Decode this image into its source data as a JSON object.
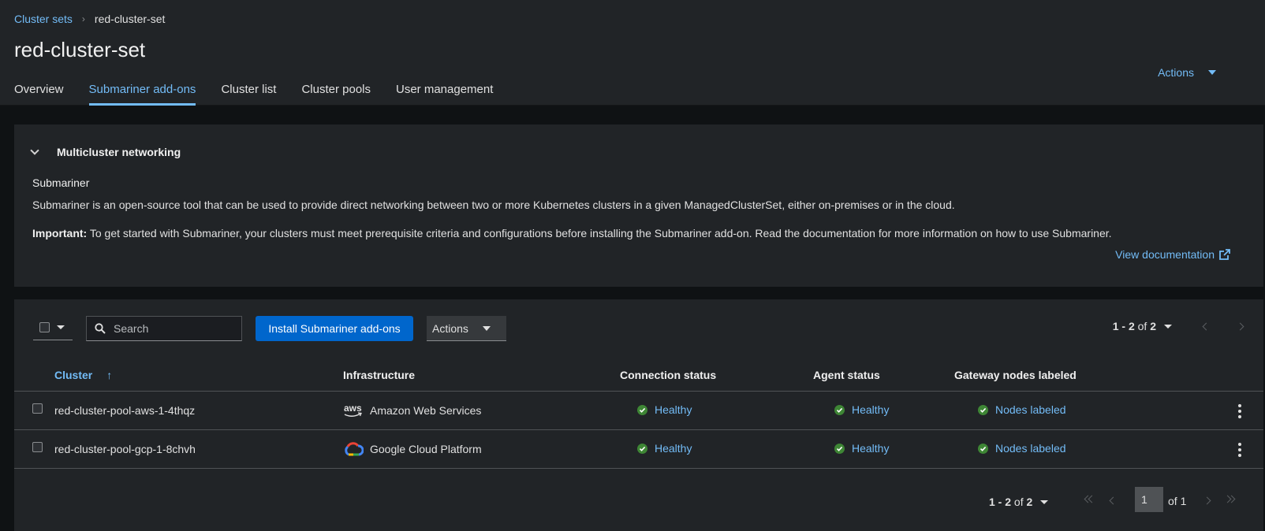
{
  "breadcrumb": {
    "parent": "Cluster sets",
    "current": "red-cluster-set"
  },
  "page": {
    "title": "red-cluster-set",
    "actions_label": "Actions"
  },
  "tabs": [
    {
      "label": "Overview",
      "active": false
    },
    {
      "label": "Submariner add-ons",
      "active": true
    },
    {
      "label": "Cluster list",
      "active": false
    },
    {
      "label": "Cluster pools",
      "active": false
    },
    {
      "label": "User management",
      "active": false
    }
  ],
  "networking": {
    "toggle_title": "Multicluster networking",
    "subtitle": "Submariner",
    "description": "Submariner is an open-source tool that can be used to provide direct networking between two or more Kubernetes clusters in a given ManagedClusterSet, either on-premises or in the cloud.",
    "important_label": "Important:",
    "important_text": " To get started with Submariner, your clusters must meet prerequisite criteria and configurations before installing the Submariner add-on. Read the documentation for more information on how to use Submariner.",
    "doc_link": "View documentation"
  },
  "toolbar": {
    "search_placeholder": "Search",
    "install_label": "Install Submariner add-ons",
    "actions_label": "Actions",
    "pagination_range": "1 - 2",
    "pagination_of": "of",
    "pagination_total": "2"
  },
  "table": {
    "headers": {
      "cluster": "Cluster",
      "infrastructure": "Infrastructure",
      "connection": "Connection status",
      "agent": "Agent status",
      "gateway": "Gateway nodes labeled"
    },
    "rows": [
      {
        "cluster": "red-cluster-pool-aws-1-4thqz",
        "infra_icon": "aws-icon",
        "infrastructure": "Amazon Web Services",
        "connection": "Healthy",
        "agent": "Healthy",
        "gateway": "Nodes labeled"
      },
      {
        "cluster": "red-cluster-pool-gcp-1-8chvh",
        "infra_icon": "gcp-icon",
        "infrastructure": "Google Cloud Platform",
        "connection": "Healthy",
        "agent": "Healthy",
        "gateway": "Nodes labeled"
      }
    ]
  },
  "bottom_pagination": {
    "range": "1 - 2",
    "of": "of",
    "total": "2",
    "page": "1",
    "of_pages": "of 1"
  },
  "colors": {
    "accent": "#73bcf7",
    "primary_button": "#0066cc",
    "success": "#3e8635",
    "surface": "#212427",
    "background": "#0f1214"
  }
}
